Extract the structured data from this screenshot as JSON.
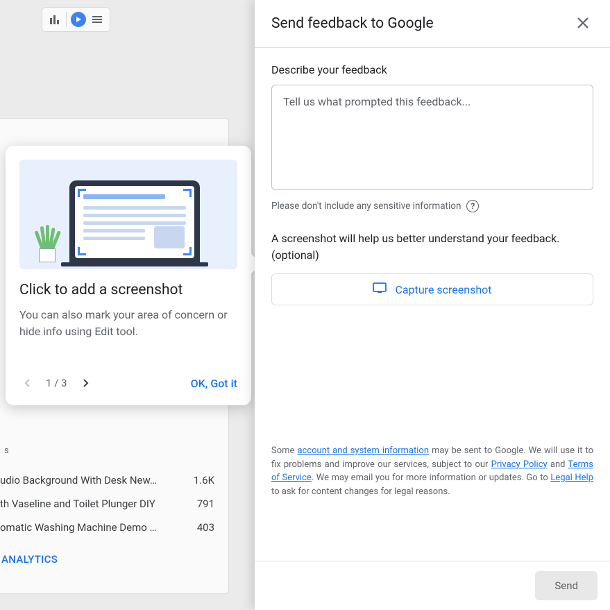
{
  "bg": {
    "views_col": "s",
    "rows": [
      {
        "title": "udio Background With Desk New…",
        "count": "1.6K"
      },
      {
        "title": "th Vaseline and Toilet Plunger DIY",
        "count": "791"
      },
      {
        "title": "omatic Washing Machine Demo …",
        "count": "403"
      }
    ],
    "analytics": "ANALYTICS"
  },
  "tooltip": {
    "title": "Click to add a screenshot",
    "desc": "You can also mark your area of concern or hide info using Edit tool.",
    "page": "1 / 3",
    "gotit": "OK, Got it"
  },
  "panel": {
    "title": "Send feedback to Google",
    "describe_label": "Describe your feedback",
    "placeholder": "Tell us what prompted this feedback...",
    "hint": "Please don't include any sensitive information",
    "sc_desc": "A screenshot will help us better understand your feedback. (optional)",
    "capture": "Capture screenshot",
    "legal": {
      "pre": "Some ",
      "l1": "account and system information",
      "t1": " may be sent to Google. We will use it to fix problems and improve our services, subject to our ",
      "l2": "Privacy Policy",
      "t2": " and ",
      "l3": "Terms of Service",
      "t3": ". We may email you for more information or updates. Go to ",
      "l4": "Legal Help",
      "t4": " to ask for content changes for legal reasons."
    },
    "send": "Send"
  }
}
